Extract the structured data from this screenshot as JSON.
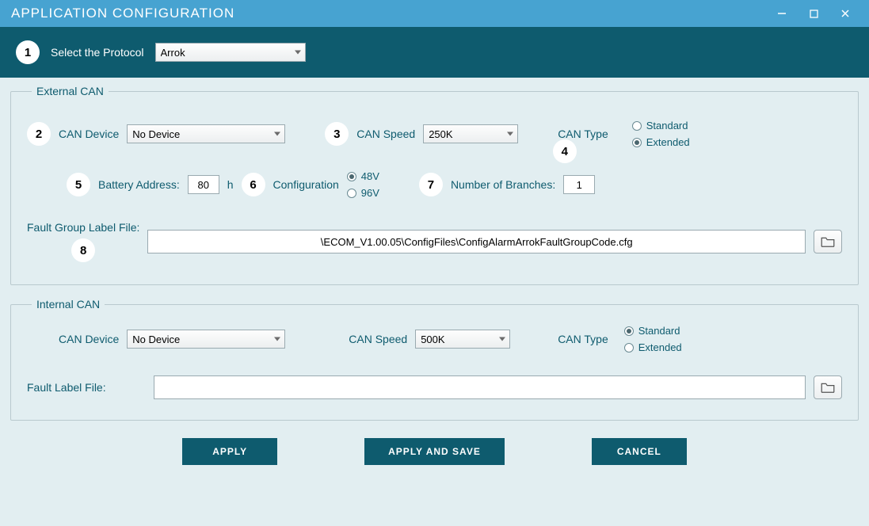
{
  "window": {
    "title": "APPLICATION CONFIGURATION"
  },
  "protocol": {
    "label": "Select the Protocol",
    "value": "Arrok"
  },
  "external": {
    "legend": "External CAN",
    "can_device": {
      "label": "CAN Device",
      "value": "No Device"
    },
    "can_speed": {
      "label": "CAN Speed",
      "value": "250K"
    },
    "can_type": {
      "label": "CAN Type",
      "standard": "Standard",
      "extended": "Extended",
      "selected": "Extended"
    },
    "battery": {
      "label": "Battery Address:",
      "value": "80",
      "unit": "h"
    },
    "config": {
      "label": "Configuration",
      "v48": "48V",
      "v96": "96V",
      "selected": "48V"
    },
    "branches": {
      "label": "Number of Branches:",
      "value": "1"
    },
    "fault_file": {
      "label": "Fault Group Label File:",
      "value": "\\ECOM_V1.00.05\\ConfigFiles\\ConfigAlarmArrokFaultGroupCode.cfg"
    }
  },
  "internal": {
    "legend": "Internal CAN",
    "can_device": {
      "label": "CAN Device",
      "value": "No Device"
    },
    "can_speed": {
      "label": "CAN Speed",
      "value": "500K"
    },
    "can_type": {
      "label": "CAN Type",
      "standard": "Standard",
      "extended": "Extended",
      "selected": "Standard"
    },
    "fault_file": {
      "label": "Fault Label File:",
      "value": ""
    }
  },
  "buttons": {
    "apply": "APPLY",
    "apply_save": "APPLY AND SAVE",
    "cancel": "CANCEL"
  },
  "badges": {
    "b1": "1",
    "b2": "2",
    "b3": "3",
    "b4": "4",
    "b5": "5",
    "b6": "6",
    "b7": "7",
    "b8": "8"
  }
}
